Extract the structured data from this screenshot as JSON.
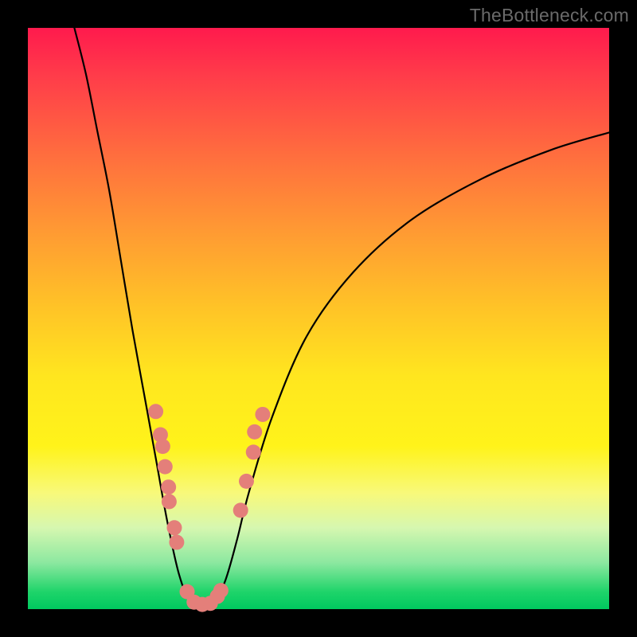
{
  "watermark": "TheBottleneck.com",
  "chart_data": {
    "type": "line",
    "title": "",
    "xlabel": "",
    "ylabel": "",
    "xlim": [
      0,
      100
    ],
    "ylim": [
      0,
      100
    ],
    "series": [
      {
        "name": "bottleneck-curve",
        "points": [
          {
            "x": 8,
            "y": 100
          },
          {
            "x": 10,
            "y": 92
          },
          {
            "x": 12,
            "y": 82
          },
          {
            "x": 14,
            "y": 72
          },
          {
            "x": 16,
            "y": 60
          },
          {
            "x": 18,
            "y": 48
          },
          {
            "x": 20,
            "y": 37
          },
          {
            "x": 22,
            "y": 26
          },
          {
            "x": 24,
            "y": 15
          },
          {
            "x": 26,
            "y": 6
          },
          {
            "x": 28,
            "y": 1
          },
          {
            "x": 30,
            "y": 0
          },
          {
            "x": 32,
            "y": 1
          },
          {
            "x": 34,
            "y": 5
          },
          {
            "x": 36,
            "y": 12
          },
          {
            "x": 38,
            "y": 20
          },
          {
            "x": 42,
            "y": 33
          },
          {
            "x": 48,
            "y": 47
          },
          {
            "x": 56,
            "y": 58
          },
          {
            "x": 66,
            "y": 67
          },
          {
            "x": 78,
            "y": 74
          },
          {
            "x": 90,
            "y": 79
          },
          {
            "x": 100,
            "y": 82
          }
        ]
      }
    ],
    "markers": [
      {
        "x": 22.0,
        "y": 34.0
      },
      {
        "x": 22.8,
        "y": 30.0
      },
      {
        "x": 23.2,
        "y": 28.0
      },
      {
        "x": 23.6,
        "y": 24.5
      },
      {
        "x": 24.2,
        "y": 21.0
      },
      {
        "x": 24.3,
        "y": 18.5
      },
      {
        "x": 25.2,
        "y": 14.0
      },
      {
        "x": 25.6,
        "y": 11.5
      },
      {
        "x": 27.4,
        "y": 3.0
      },
      {
        "x": 28.6,
        "y": 1.2
      },
      {
        "x": 30.0,
        "y": 0.8
      },
      {
        "x": 31.4,
        "y": 1.0
      },
      {
        "x": 32.6,
        "y": 2.2
      },
      {
        "x": 33.2,
        "y": 3.2
      },
      {
        "x": 36.6,
        "y": 17.0
      },
      {
        "x": 37.6,
        "y": 22.0
      },
      {
        "x": 38.8,
        "y": 27.0
      },
      {
        "x": 39.0,
        "y": 30.5
      },
      {
        "x": 40.4,
        "y": 33.5
      }
    ],
    "gradient_stops": [
      {
        "pos": 0,
        "color": "#ff1a4d"
      },
      {
        "pos": 50,
        "color": "#ffd21f"
      },
      {
        "pos": 100,
        "color": "#00c95f"
      }
    ]
  }
}
